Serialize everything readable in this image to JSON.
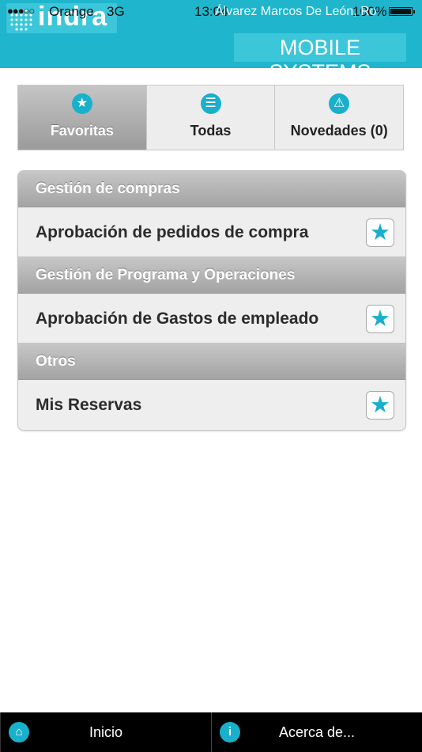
{
  "status_bar": {
    "signal": "●●●○○",
    "carrier": "Orange",
    "network": "3G",
    "time": "13:04",
    "battery_pct": "100%"
  },
  "header": {
    "user_name": "Álvarez Marcos De León, Ro",
    "logo_text": "indra",
    "subtitle": "MOBILE SYSTEMS"
  },
  "tabs": [
    {
      "label": "Favoritas",
      "icon": "star-icon",
      "icon_glyph": "★",
      "active": true
    },
    {
      "label": "Todas",
      "icon": "list-icon",
      "icon_glyph": "☰",
      "active": false
    },
    {
      "label": "Novedades (0)",
      "icon": "warning-icon",
      "icon_glyph": "⚠",
      "active": false
    }
  ],
  "groups": [
    {
      "header": "Gestión de compras",
      "items": [
        {
          "label": "Aprobación de pedidos de compra"
        }
      ]
    },
    {
      "header": "Gestión de Programa y Operaciones",
      "items": [
        {
          "label": "Aprobación de Gastos de empleado"
        }
      ]
    },
    {
      "header": "Otros",
      "items": [
        {
          "label": "Mis Reservas"
        }
      ]
    }
  ],
  "star_glyph": "★",
  "footer": {
    "home_label": "Inicio",
    "home_icon_glyph": "⌂",
    "about_label": "Acerca de...",
    "about_icon_glyph": "i"
  },
  "colors": {
    "header_bg": "#1fb5cc",
    "accent": "#19b0cb",
    "footer_bg": "#000000"
  }
}
